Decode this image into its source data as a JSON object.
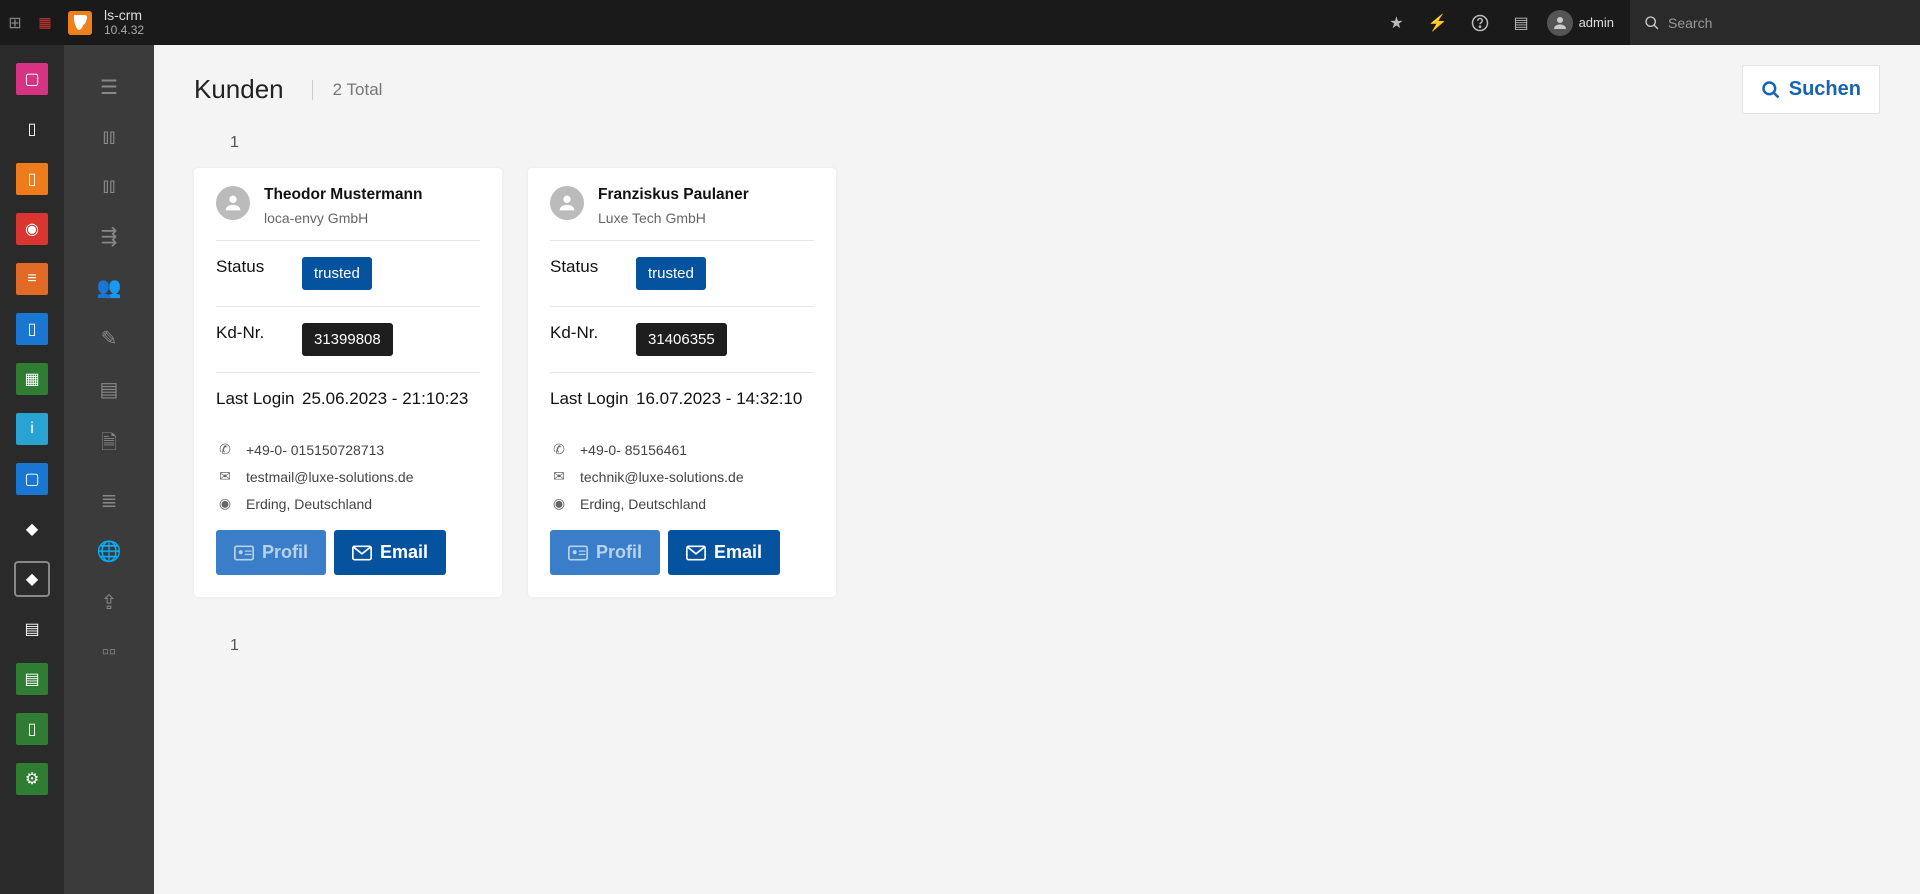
{
  "topbar": {
    "app_name": "ls-crm",
    "version": "10.4.32",
    "admin_label": "admin",
    "search_placeholder": "Search"
  },
  "page": {
    "title": "Kunden",
    "total_label": "2 Total",
    "search_button": "Suchen",
    "pager_top": "1",
    "pager_bottom": "1"
  },
  "labels": {
    "status": "Status",
    "kdnr": "Kd-Nr.",
    "last_login": "Last Login",
    "profil": "Profil",
    "email_btn": "Email"
  },
  "customers": [
    {
      "name": "Theodor Mustermann",
      "company": "loca-envy GmbH",
      "status": "trusted",
      "kdnr": "31399808",
      "last_login": "25.06.2023 - 21:10:23",
      "phone": "+49-0- 015150728713",
      "email": "testmail@luxe-solutions.de",
      "location": "Erding, Deutschland"
    },
    {
      "name": "Franziskus Paulaner",
      "company": "Luxe Tech GmbH",
      "status": "trusted",
      "kdnr": "31406355",
      "last_login": "16.07.2023 - 14:32:10",
      "phone": "+49-0- 85156461",
      "email": "technik@luxe-solutions.de",
      "location": "Erding, Deutschland"
    }
  ]
}
